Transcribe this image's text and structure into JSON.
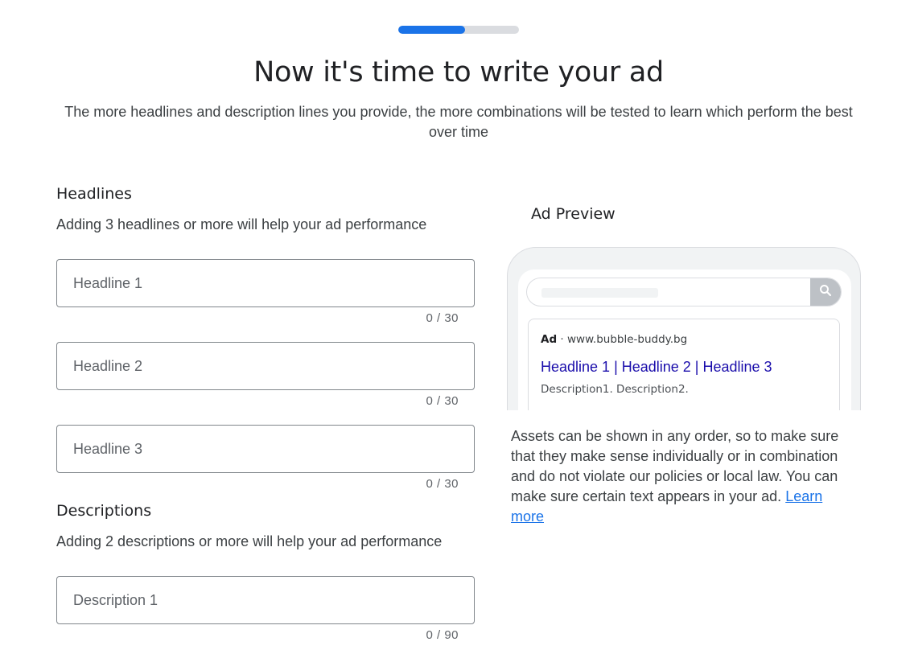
{
  "progress": {
    "percent": 55,
    "color": "#1a73e8"
  },
  "header": {
    "title": "Now it's time to write your ad",
    "subtitle": "The more headlines and description lines you provide, the more combinations will be tested to learn which perform the best over time"
  },
  "headlines": {
    "title": "Headlines",
    "hint": "Adding 3 headlines or more will help your ad performance",
    "fields": [
      {
        "placeholder": "Headline 1",
        "value": "",
        "counter": "0 / 30"
      },
      {
        "placeholder": "Headline 2",
        "value": "",
        "counter": "0 / 30"
      },
      {
        "placeholder": "Headline 3",
        "value": "",
        "counter": "0 / 30"
      }
    ]
  },
  "descriptions": {
    "title": "Descriptions",
    "hint": "Adding 2 descriptions or more will help your ad performance",
    "fields": [
      {
        "placeholder": "Description 1",
        "value": "",
        "counter": "0 / 90"
      }
    ]
  },
  "preview": {
    "title": "Ad Preview",
    "search_icon": "search-icon",
    "ad_badge": "Ad",
    "separator": "·",
    "domain": "www.bubble-buddy.bg",
    "headline": "Headline 1 | Headline 2 | Headline 3",
    "description": "Description1. Description2.",
    "disclaimer_text": "Assets can be shown in any order, so to make sure that they make sense individually or in combination and do not violate our policies or local law. You can make sure certain text appears in your ad.",
    "learn_more": "Learn more"
  }
}
